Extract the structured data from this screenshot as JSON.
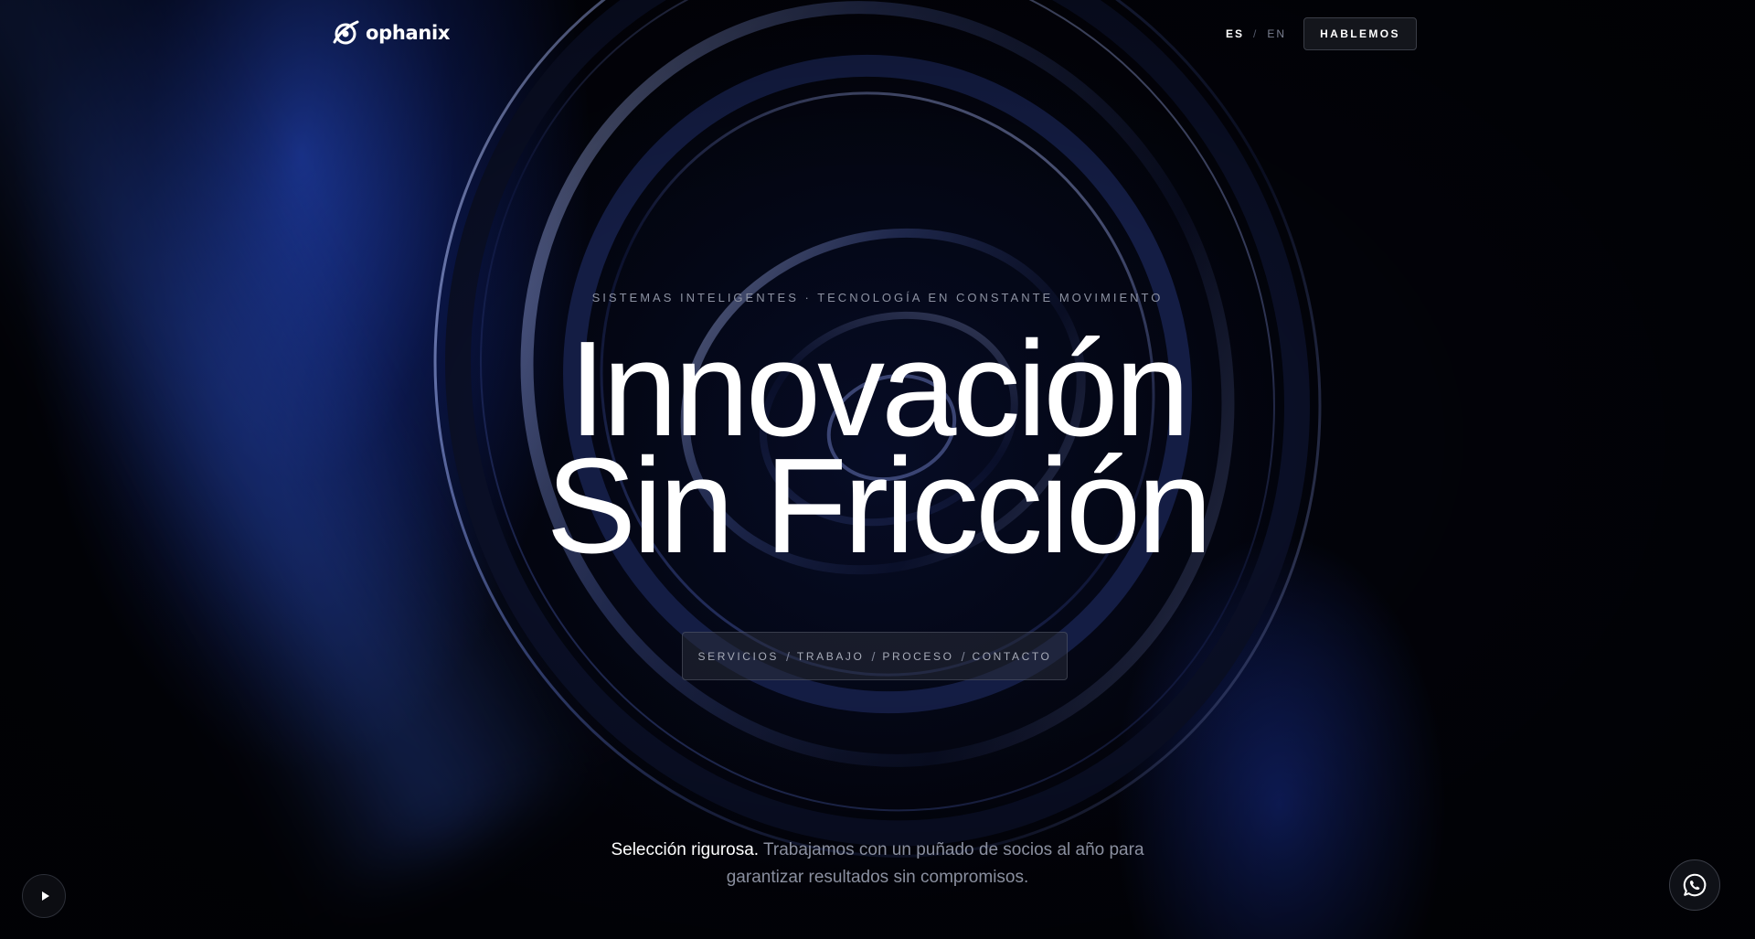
{
  "brand": {
    "name": "ophanix"
  },
  "header": {
    "languages": [
      {
        "code": "ES",
        "active": true
      },
      {
        "code": "EN",
        "active": false
      }
    ],
    "lang_separator": "/",
    "cta_label": "HABLEMOS"
  },
  "hero": {
    "eyebrow": "SISTEMAS INTELIGENTES · TECNOLOGÍA EN CONSTANTE MOVIMIENTO",
    "headline_line1": "Innovación",
    "headline_line2": "Sin Fricción"
  },
  "nav": {
    "items": [
      "SERVICIOS",
      "TRABAJO",
      "PROCESO",
      "CONTACTO"
    ],
    "separator": "/"
  },
  "tagline": {
    "strong": "Selección rigurosa.",
    "muted_line1": "Trabajamos con un puñado de socios al año para",
    "muted_line2": "garantizar resultados sin compromisos."
  },
  "icons": {
    "logo": "ophanix-logo-icon",
    "play": "play-icon",
    "whatsapp": "whatsapp-icon"
  },
  "colors": {
    "background": "#02030a",
    "accent_blue": "#2f5bff",
    "text_primary": "#ffffff",
    "text_muted": "#8a8f9f"
  }
}
